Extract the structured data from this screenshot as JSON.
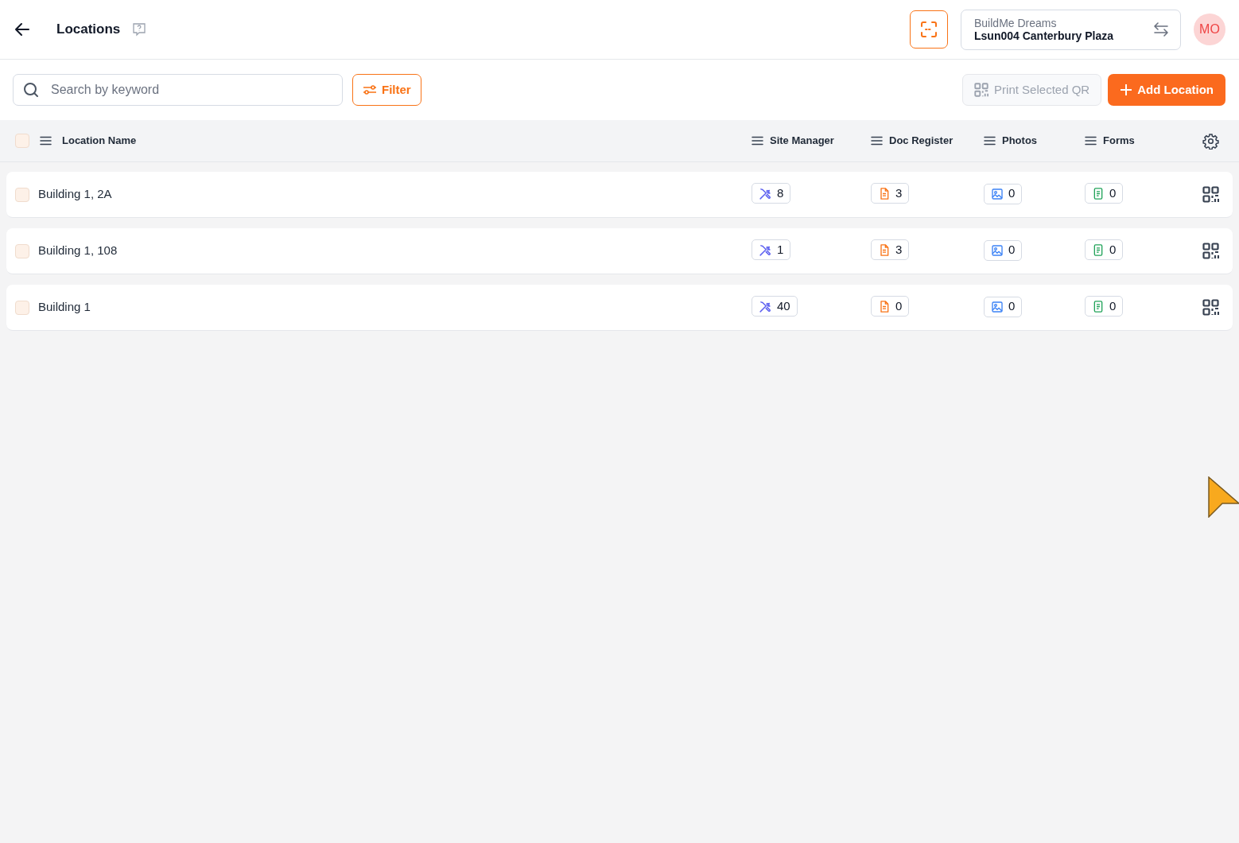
{
  "header": {
    "title": "Locations",
    "project": {
      "company": "BuildMe Dreams",
      "name": "Lsun004 Canterbury Plaza"
    },
    "avatar": "MO"
  },
  "toolbar": {
    "search": {
      "placeholder": "Search by keyword"
    },
    "filter": "Filter",
    "print_qr": {
      "label": "Print Selected QR",
      "disabled": true
    },
    "add": "Add Location"
  },
  "table": {
    "select_all": {
      "checked": false
    },
    "columns": [
      "Location Name",
      "Site Manager",
      "Doc Register",
      "Photos",
      "Forms"
    ],
    "rows": [
      {
        "checked": false,
        "name": "Building 1, 2A",
        "site_manager": "8",
        "doc_register": "3",
        "photos": "0",
        "forms": "0"
      },
      {
        "checked": false,
        "name": "Building 1, 108",
        "site_manager": "1",
        "doc_register": "3",
        "photos": "0",
        "forms": "0"
      },
      {
        "checked": false,
        "name": "Building 1",
        "site_manager": "40",
        "doc_register": "0",
        "photos": "0",
        "forms": "0"
      }
    ]
  }
}
